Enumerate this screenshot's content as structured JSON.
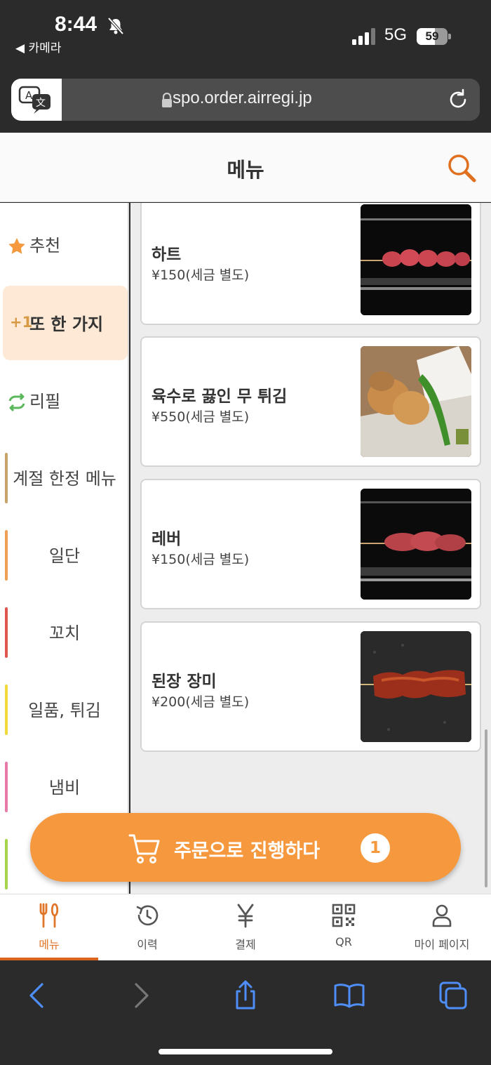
{
  "status_bar": {
    "time": "8:44",
    "back_app": "◀ 카메라",
    "network": "5G",
    "battery_percent": 59
  },
  "browser": {
    "url": "spo.order.airregi.jp"
  },
  "header": {
    "title": "메뉴"
  },
  "sidebar": {
    "items": [
      {
        "label": "추천",
        "icon": "star-icon"
      },
      {
        "label": "또 한 가지",
        "prefix": "+1",
        "active": true
      },
      {
        "label": "리필",
        "icon": "refill-icon"
      },
      {
        "label": "계절 한정 메뉴",
        "bar_color": "#c8a46a"
      },
      {
        "label": "일단",
        "bar_color": "#f0a055"
      },
      {
        "label": "꼬치",
        "bar_color": "#e0564c"
      },
      {
        "label": "일품, 튀김",
        "bar_color": "#f2d93a"
      },
      {
        "label": "냄비",
        "bar_color": "#e87aa8"
      },
      {
        "label": "",
        "bar_color": "#a6d44a"
      }
    ]
  },
  "menu_items": [
    {
      "name": "하트",
      "price": "¥150(세금 별도)",
      "photo": "skewer-hearts-photo"
    },
    {
      "name": "육수로 끓인 무 튀김",
      "price": "¥550(세금 별도)",
      "photo": "fried-radish-photo"
    },
    {
      "name": "레버",
      "price": "¥150(세금 별도)",
      "photo": "skewer-liver-photo"
    },
    {
      "name": "된장 장미",
      "price": "¥200(세금 별도)",
      "photo": "skewer-miso-photo"
    }
  ],
  "order_button": {
    "label": "주문으로 진행하다",
    "count": "1"
  },
  "tabs": [
    {
      "label": "메뉴",
      "icon": "fork-knife-icon",
      "active": true
    },
    {
      "label": "이력",
      "icon": "history-icon"
    },
    {
      "label": "결제",
      "icon": "yen-icon"
    },
    {
      "label": "QR",
      "icon": "qr-icon"
    },
    {
      "label": "마이 페이지",
      "icon": "person-icon"
    }
  ],
  "colors": {
    "accent": "#f5983e",
    "accent_dark": "#d9641e",
    "active_category_bg": "#fde9d6"
  }
}
